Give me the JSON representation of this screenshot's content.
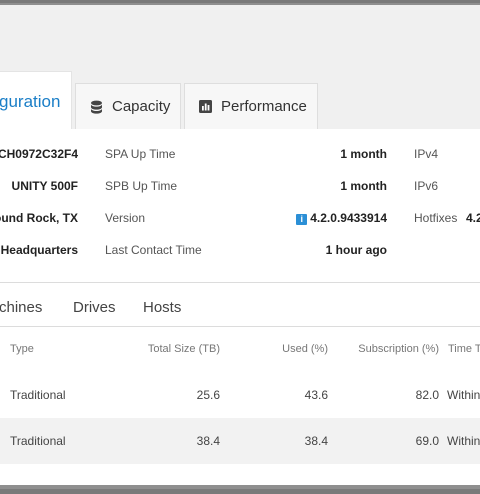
{
  "tabs": [
    {
      "label": "guration",
      "icon": "",
      "active": true
    },
    {
      "label": "Capacity",
      "icon": "database-icon",
      "active": false
    },
    {
      "label": "Performance",
      "icon": "bar-chart-icon",
      "active": false
    }
  ],
  "system": {
    "left_values": [
      "CH0972C32F4",
      "UNITY 500F",
      "ound Rock, TX",
      "E Headquarters"
    ],
    "mid_labels": [
      "SPA Up Time",
      "SPB Up Time",
      "Version",
      "Last Contact Time"
    ],
    "mid_values": [
      "1 month",
      "1 month",
      "4.2.0.9433914",
      "1 hour ago"
    ],
    "version_badge": "i",
    "right_labels": [
      "IPv4",
      "IPv6",
      "Hotfixes"
    ],
    "hotfixes_value": "4.2"
  },
  "subtabs": [
    "chines",
    "Drives",
    "Hosts"
  ],
  "table": {
    "headers": [
      "Type",
      "Total Size (TB)",
      "Used (%)",
      "Subscription (%)",
      "Time T"
    ],
    "rows": [
      [
        "Traditional",
        "25.6",
        "43.6",
        "82.0",
        "Within"
      ],
      [
        "Traditional",
        "38.4",
        "38.4",
        "69.0",
        "Within"
      ]
    ]
  }
}
